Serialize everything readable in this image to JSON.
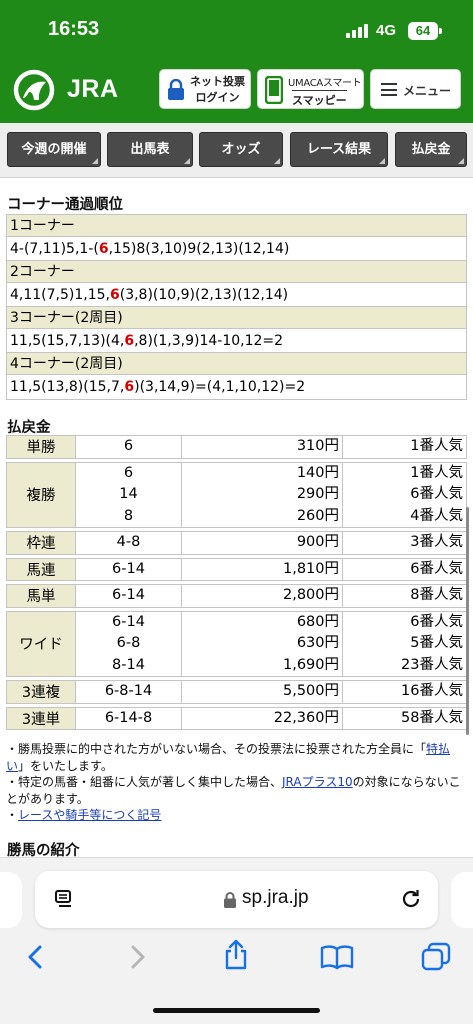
{
  "status_bar": {
    "time": "16:53",
    "network": "4G",
    "battery": "64"
  },
  "header": {
    "logo_text": "JRA",
    "login_line1": "ネット投票",
    "login_line2": "ログイン",
    "umaca_line1": "UMACAスマート",
    "umaca_line2": "スマッピー",
    "menu_label": "メニュー"
  },
  "nav": [
    "今週の開催",
    "出馬表",
    "オッズ",
    "レース結果",
    "払戻金"
  ],
  "corner_section": {
    "title": "コーナー通過順位",
    "rows": [
      {
        "label": "1コーナー",
        "pre": "4-(7,11)5,1-(",
        "hl": "6",
        "post": ",15)8(3,10)9(2,13)(12,14)"
      },
      {
        "label": "2コーナー",
        "pre": "4,11(7,5)1,15,",
        "hl": "6",
        "post": "(3,8)(10,9)(2,13)(12,14)"
      },
      {
        "label": "3コーナー(2周目)",
        "pre": "11,5(15,7,13)(4,",
        "hl": "6",
        "post": ",8)(1,3,9)14-10,12=2"
      },
      {
        "label": "4コーナー(2周目)",
        "pre": "11,5(13,8)(15,7,",
        "hl": "6",
        "post": ")(3,14,9)=(4,1,10,12)=2"
      }
    ]
  },
  "payout_section": {
    "title": "払戻金",
    "rows": [
      {
        "bet": "単勝",
        "entries": [
          {
            "combo": "6",
            "payout": "310円",
            "pop": "1番人気"
          }
        ]
      },
      {
        "bet": "複勝",
        "entries": [
          {
            "combo": "6",
            "payout": "140円",
            "pop": "1番人気"
          },
          {
            "combo": "14",
            "payout": "290円",
            "pop": "6番人気"
          },
          {
            "combo": "8",
            "payout": "260円",
            "pop": "4番人気"
          }
        ]
      },
      {
        "bet": "枠連",
        "entries": [
          {
            "combo": "4-8",
            "payout": "900円",
            "pop": "3番人気"
          }
        ]
      },
      {
        "bet": "馬連",
        "entries": [
          {
            "combo": "6-14",
            "payout": "1,810円",
            "pop": "6番人気"
          }
        ]
      },
      {
        "bet": "馬単",
        "entries": [
          {
            "combo": "6-14",
            "payout": "2,800円",
            "pop": "8番人気"
          }
        ]
      },
      {
        "bet": "ワイド",
        "entries": [
          {
            "combo": "6-14",
            "payout": "680円",
            "pop": "6番人気"
          },
          {
            "combo": "6-8",
            "payout": "630円",
            "pop": "5番人気"
          },
          {
            "combo": "8-14",
            "payout": "1,690円",
            "pop": "23番人気"
          }
        ]
      },
      {
        "bet": "3連複",
        "entries": [
          {
            "combo": "6-8-14",
            "payout": "5,500円",
            "pop": "16番人気"
          }
        ]
      },
      {
        "bet": "3連単",
        "entries": [
          {
            "combo": "6-14-8",
            "payout": "22,360円",
            "pop": "58番人気"
          }
        ]
      }
    ]
  },
  "notes": {
    "n1_pre": "・勝馬投票に的中された方がいない場合、その投票法に投票された方全員に「",
    "n1_link": "特払い",
    "n1_post": "」をいたします。",
    "n2_pre": "・特定の馬番・組番に人気が著しく集中した場合、",
    "n2_link": "JRAプラス10",
    "n2_post": "の対象にならないことがあります。",
    "n3_pre": "・",
    "n3_link": "レースや騎手等につく記号"
  },
  "winner_section": {
    "title": "勝馬の紹介"
  },
  "browser": {
    "url": "sp.jra.jp"
  },
  "colors": {
    "header_green": "#1f8a17",
    "highlight_red": "#d40000",
    "row_header_bg": "#ecebcf",
    "link_blue": "#1a3fb5"
  }
}
